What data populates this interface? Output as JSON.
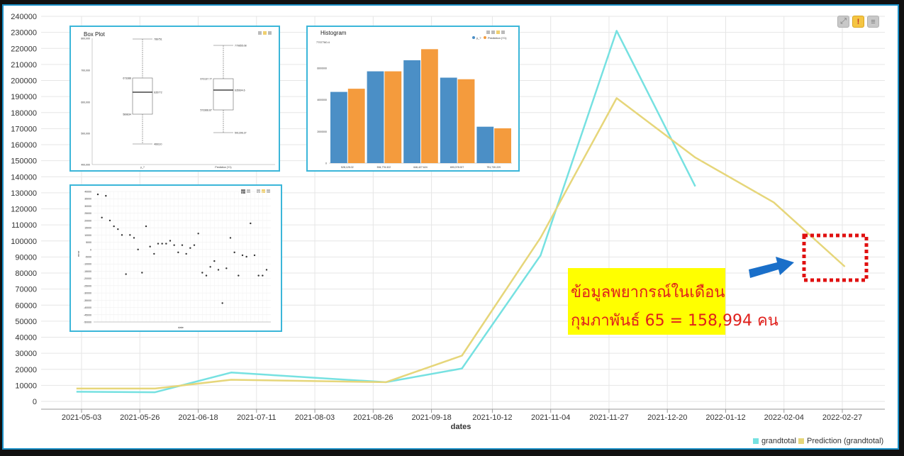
{
  "colors": {
    "grandtotal": "#76e1e1",
    "prediction": "#e6d67a",
    "highlight_box": "#e01010",
    "arrow": "#1a6fc9",
    "callout_bg": "#ffff00",
    "callout_text": "#e0201c",
    "frame": "#1a8fc7"
  },
  "toolbar": {
    "expand_icon": "expand-icon",
    "warning_label": "!",
    "menu_icon": "menu-icon"
  },
  "chart_data": {
    "type": "line",
    "xlabel": "dates",
    "ylabel": "",
    "ylim": [
      0,
      240000
    ],
    "yticks": [
      0,
      10000,
      20000,
      30000,
      40000,
      50000,
      60000,
      70000,
      80000,
      90000,
      100000,
      110000,
      120000,
      130000,
      140000,
      150000,
      160000,
      170000,
      180000,
      190000,
      200000,
      210000,
      220000,
      230000,
      240000
    ],
    "xticks": [
      "2021-05-03",
      "2021-05-26",
      "2021-06-18",
      "2021-07-11",
      "2021-08-03",
      "2021-08-26",
      "2021-09-18",
      "2021-10-12",
      "2021-11-04",
      "2021-11-27",
      "2021-12-20",
      "2022-01-12",
      "2022-02-04",
      "2022-02-27"
    ],
    "grid": true,
    "legend_position": "bottom-right",
    "series": [
      {
        "name": "grandtotal",
        "x": [
          "2021-05-01",
          "2021-06-01",
          "2021-07-01",
          "2021-08-31",
          "2021-09-30",
          "2021-10-31",
          "2021-11-30",
          "2021-12-31"
        ],
        "values": [
          6000,
          5700,
          18000,
          12000,
          20500,
          91000,
          231000,
          134000
        ]
      },
      {
        "name": "Prediction (grandtotal)",
        "x": [
          "2021-05-01",
          "2021-06-01",
          "2021-07-01",
          "2021-08-31",
          "2021-09-30",
          "2021-10-31",
          "2021-11-30",
          "2021-12-31",
          "2022-01-31",
          "2022-02-28"
        ],
        "values": [
          8000,
          8000,
          13500,
          12000,
          28500,
          102000,
          189000,
          152000,
          124000,
          84000
        ]
      }
    ]
  },
  "annotation": {
    "line1": "ข้อมูลพยากรณ์ในเดือน",
    "line2": "กุมภาพันธ์ 65 = 158,994 คน"
  },
  "legend": {
    "grandtotal": "grandtotal",
    "prediction": "Prediction (grandtotal)"
  },
  "insets": {
    "boxplot": {
      "title": "Box Plot",
      "yticks": [
        "800,000",
        "700,000",
        "600,000",
        "500,000",
        "400,000"
      ],
      "categories": [
        "y_?",
        "Prediction (Y1)"
      ],
      "boxes": [
        {
          "max_label": "786751",
          "q3_label": "673388",
          "median_label": "635772",
          "q1_label": "589834",
          "min_label": "466110"
        },
        {
          "max_label": "779655.08",
          "q3_label": "673137.77",
          "median_label": "635694.6",
          "q1_label": "573368.87",
          "min_label": "501296.37"
        }
      ]
    },
    "histogram": {
      "title": "Histogram",
      "top_label": "7707760.4",
      "legend": [
        "y_?",
        "Prediction (Y1)"
      ],
      "yticks": [
        "6000000",
        "4000000",
        "2000000",
        "0"
      ],
      "categories": [
        "528,125.02",
        "594,776.322",
        "646,427.624",
        "690,078.927",
        "751,730.229"
      ],
      "series_a": [
        4500000,
        5800000,
        6500000,
        5400000,
        2300000
      ],
      "series_b": [
        4700000,
        5800000,
        7200000,
        5300000,
        2200000
      ],
      "ymax": 7707760
    },
    "scatter": {
      "ylabel": "error",
      "xlabel": "date",
      "yticks": [
        "40000",
        "35000",
        "30000",
        "25000",
        "20000",
        "15000",
        "10000",
        "5000",
        "0",
        "-5000",
        "-10000",
        "-15000",
        "-20000",
        "-25000",
        "-30000",
        "-35000",
        "-40000",
        "-45000",
        "-50000"
      ],
      "points": [
        38000,
        22000,
        37000,
        20000,
        16000,
        14000,
        10000,
        -17000,
        10000,
        8000,
        0,
        -16000,
        16000,
        2000,
        -3000,
        4000,
        4000,
        4000,
        6000,
        3000,
        -2000,
        3000,
        -3000,
        1000,
        3000,
        11000,
        -16000,
        -18000,
        -12000,
        -8000,
        -14000,
        -37000,
        -13000,
        8000,
        -2000,
        -18000,
        -4000,
        -5000,
        18000,
        -4000,
        -18000,
        -18000,
        -14000
      ],
      "ymin": -50000,
      "ymax": 40000
    }
  }
}
